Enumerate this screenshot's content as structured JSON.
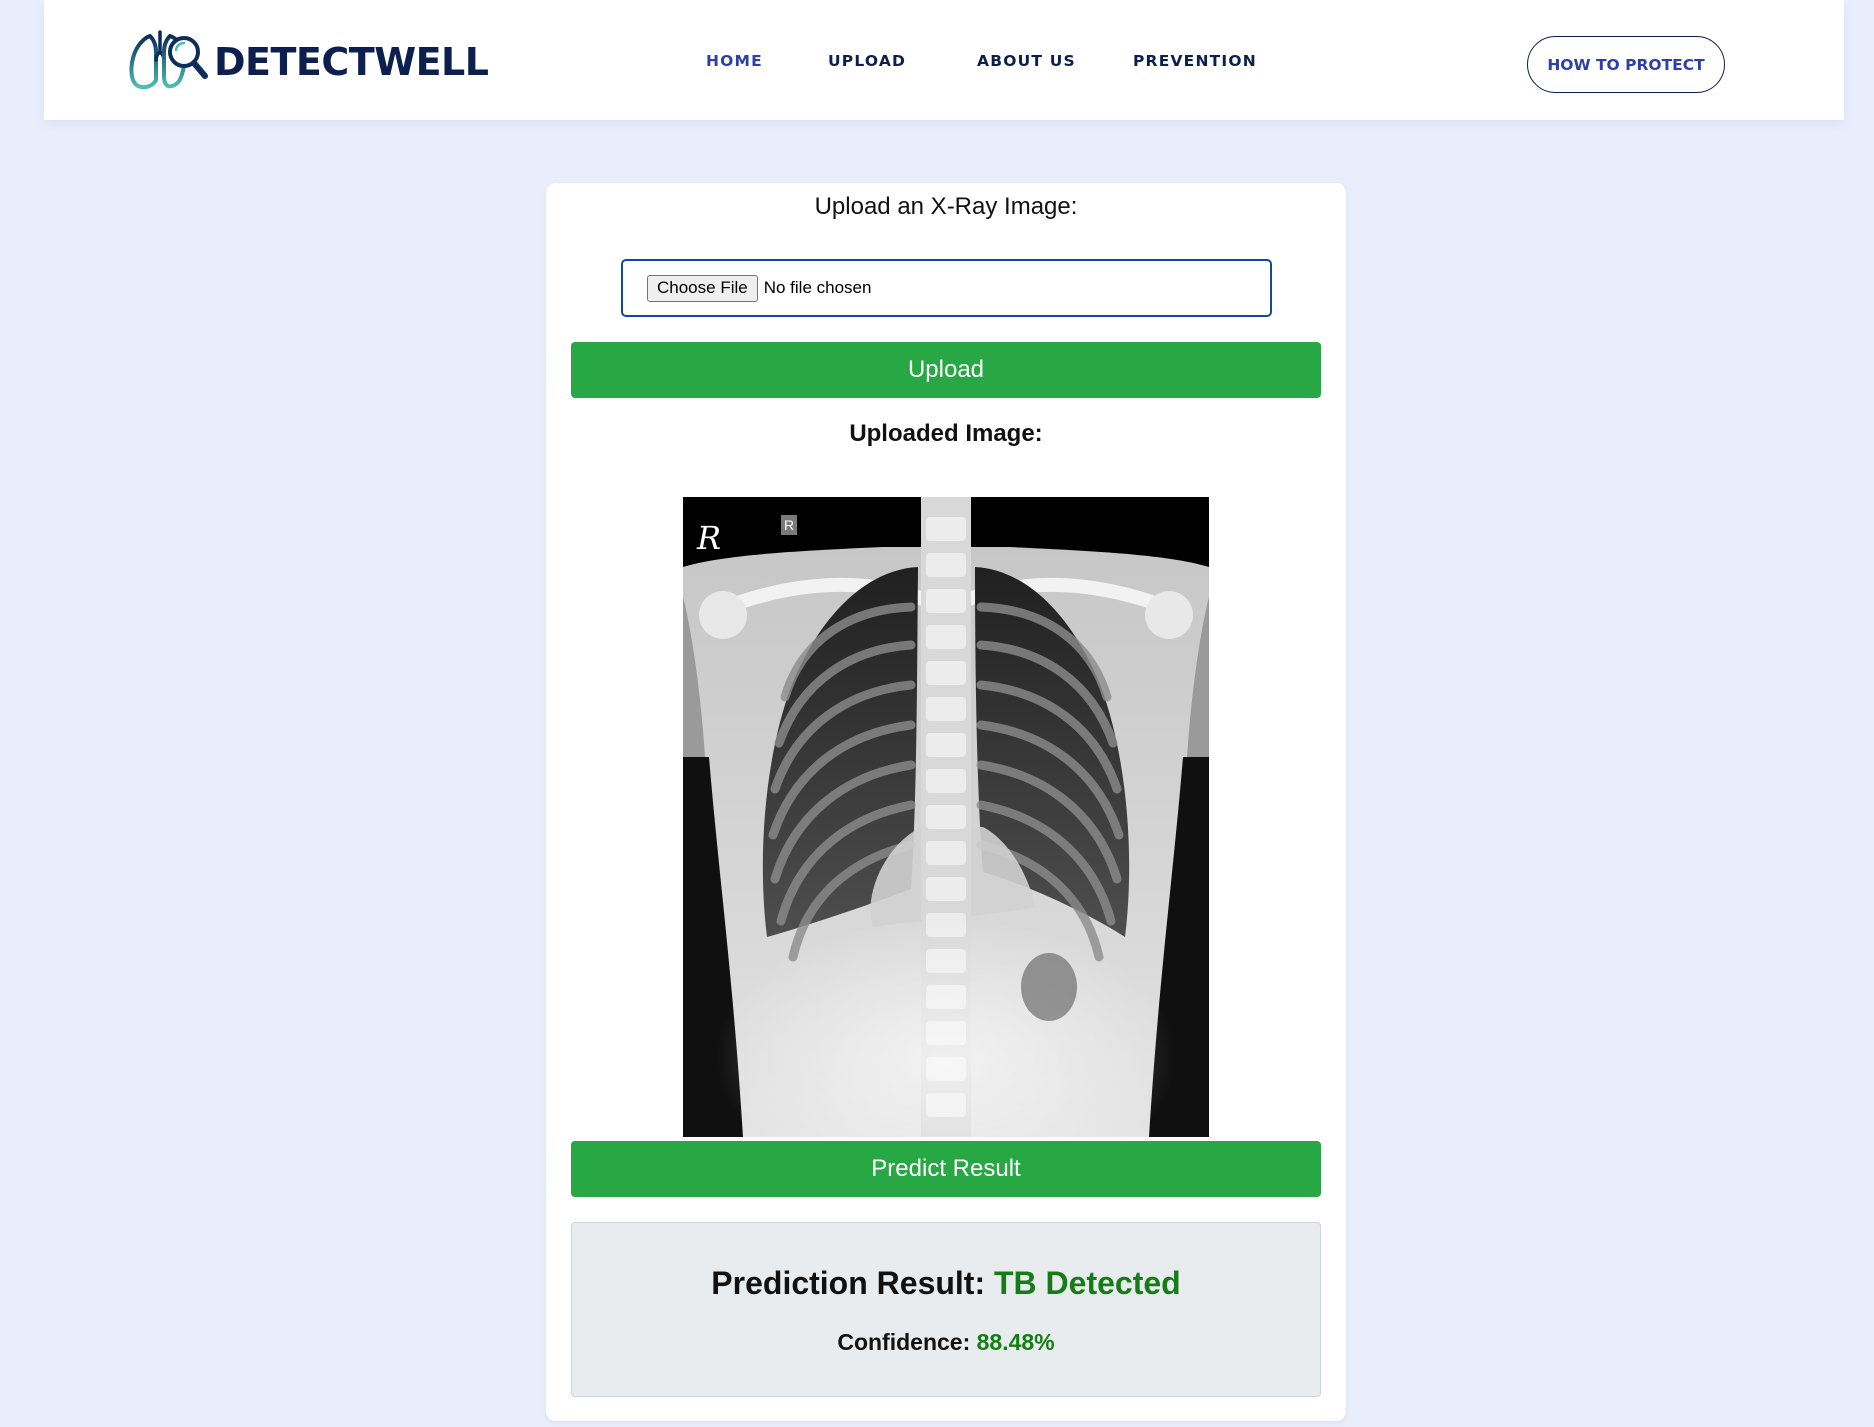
{
  "brand": {
    "name": "DETECTWELL",
    "logo_icon": "lungs-magnifier-icon",
    "colors": {
      "navy": "#0c1f4e",
      "teal": "#4dbfb0"
    }
  },
  "nav": {
    "items": [
      {
        "label": "HOME",
        "active": true
      },
      {
        "label": "UPLOAD",
        "active": false
      },
      {
        "label": "ABOUT US",
        "active": false
      },
      {
        "label": "PREVENTION",
        "active": false
      }
    ],
    "cta_label": "HOW TO PROTECT"
  },
  "upload": {
    "title": "Upload an X-Ray Image:",
    "choose_file_label": "Choose File",
    "file_status": "No file chosen",
    "upload_button": "Upload"
  },
  "preview": {
    "label": "Uploaded Image:",
    "image": "chest-xray",
    "handwritten_marker": "R",
    "box_marker": "R"
  },
  "predict": {
    "button_label": "Predict Result"
  },
  "result": {
    "prediction_label": "Prediction Result:",
    "prediction_value": "TB Detected",
    "confidence_label": "Confidence:",
    "confidence_value": "88.48%",
    "value_color": "#167d16"
  },
  "colors": {
    "page_bg": "#e8eefc",
    "button_green": "#28a745",
    "nav_active": "#2e40a8"
  }
}
